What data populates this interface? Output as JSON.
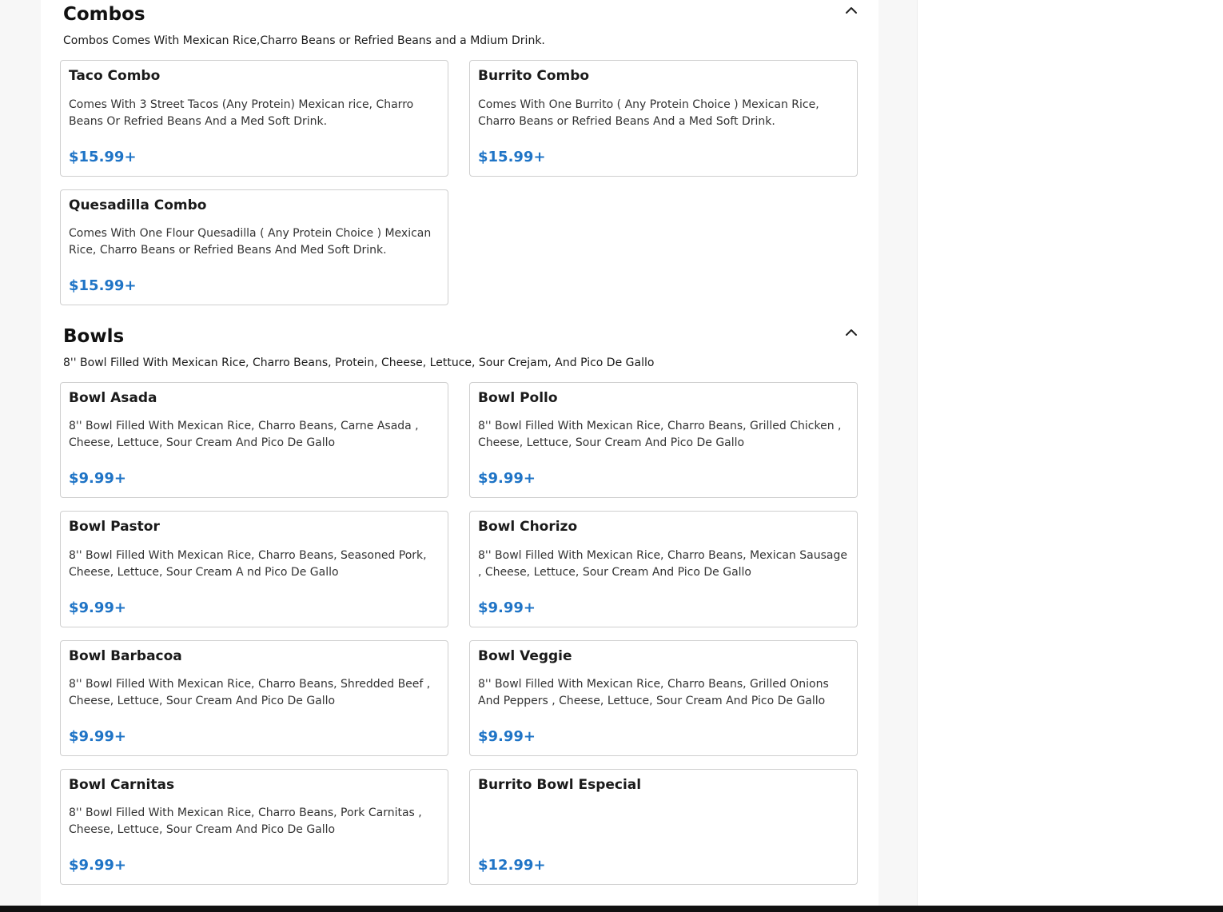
{
  "sections": [
    {
      "title": "Combos",
      "description": "Combos Comes With Mexican Rice,Charro Beans or Refried Beans and a Mdium Drink.",
      "items": [
        {
          "name": "Taco Combo",
          "description": "Comes With 3 Street Tacos (Any Protein) Mexican rice, Charro Beans Or Refried Beans And a Med Soft Drink.",
          "price": "$15.99+"
        },
        {
          "name": "Burrito Combo",
          "description": "Comes With One Burrito ( Any Protein Choice ) Mexican Rice, Charro Beans or Refried Beans And a Med Soft Drink.",
          "price": "$15.99+"
        },
        {
          "name": "Quesadilla Combo",
          "description": "Comes With One Flour Quesadilla ( Any Protein Choice ) Mexican Rice, Charro Beans or Refried Beans And Med Soft Drink.",
          "price": "$15.99+"
        }
      ]
    },
    {
      "title": "Bowls",
      "description": "8'' Bowl Filled With Mexican Rice, Charro Beans, Protein, Cheese, Lettuce, Sour Crejam, And Pico De Gallo",
      "items": [
        {
          "name": "Bowl Asada",
          "description": "8'' Bowl Filled With Mexican Rice, Charro Beans, Carne Asada , Cheese, Lettuce, Sour Cream And Pico De Gallo",
          "price": "$9.99+"
        },
        {
          "name": "Bowl Pollo",
          "description": "8'' Bowl Filled With Mexican Rice, Charro Beans, Grilled Chicken , Cheese, Lettuce, Sour Cream And Pico De Gallo",
          "price": "$9.99+"
        },
        {
          "name": "Bowl Pastor",
          "description": "8'' Bowl Filled With Mexican Rice, Charro Beans, Seasoned Pork, Cheese, Lettuce, Sour Cream A nd Pico De Gallo",
          "price": "$9.99+"
        },
        {
          "name": "Bowl Chorizo",
          "description": "8'' Bowl Filled With Mexican Rice, Charro Beans, Mexican Sausage , Cheese, Lettuce, Sour Cream And Pico De Gallo",
          "price": "$9.99+"
        },
        {
          "name": "Bowl Barbacoa",
          "description": "8'' Bowl Filled With Mexican Rice, Charro Beans, Shredded Beef , Cheese, Lettuce, Sour Cream And Pico De Gallo",
          "price": "$9.99+"
        },
        {
          "name": "Bowl Veggie",
          "description": "8'' Bowl Filled With Mexican Rice, Charro Beans, Grilled Onions And Peppers , Cheese, Lettuce, Sour Cream And Pico De Gallo",
          "price": "$9.99+"
        },
        {
          "name": "Bowl Carnitas",
          "description": "8'' Bowl Filled With Mexican Rice, Charro Beans, Pork Carnitas , Cheese, Lettuce, Sour Cream And Pico De Gallo",
          "price": "$9.99+"
        },
        {
          "name": "Burrito Bowl Especial",
          "description": "",
          "price": "$12.99+"
        }
      ]
    }
  ],
  "icons": {
    "collapse": "chevron-up-icon"
  },
  "colors": {
    "price": "#1f74c6",
    "card_border": "#cfcfcf"
  }
}
